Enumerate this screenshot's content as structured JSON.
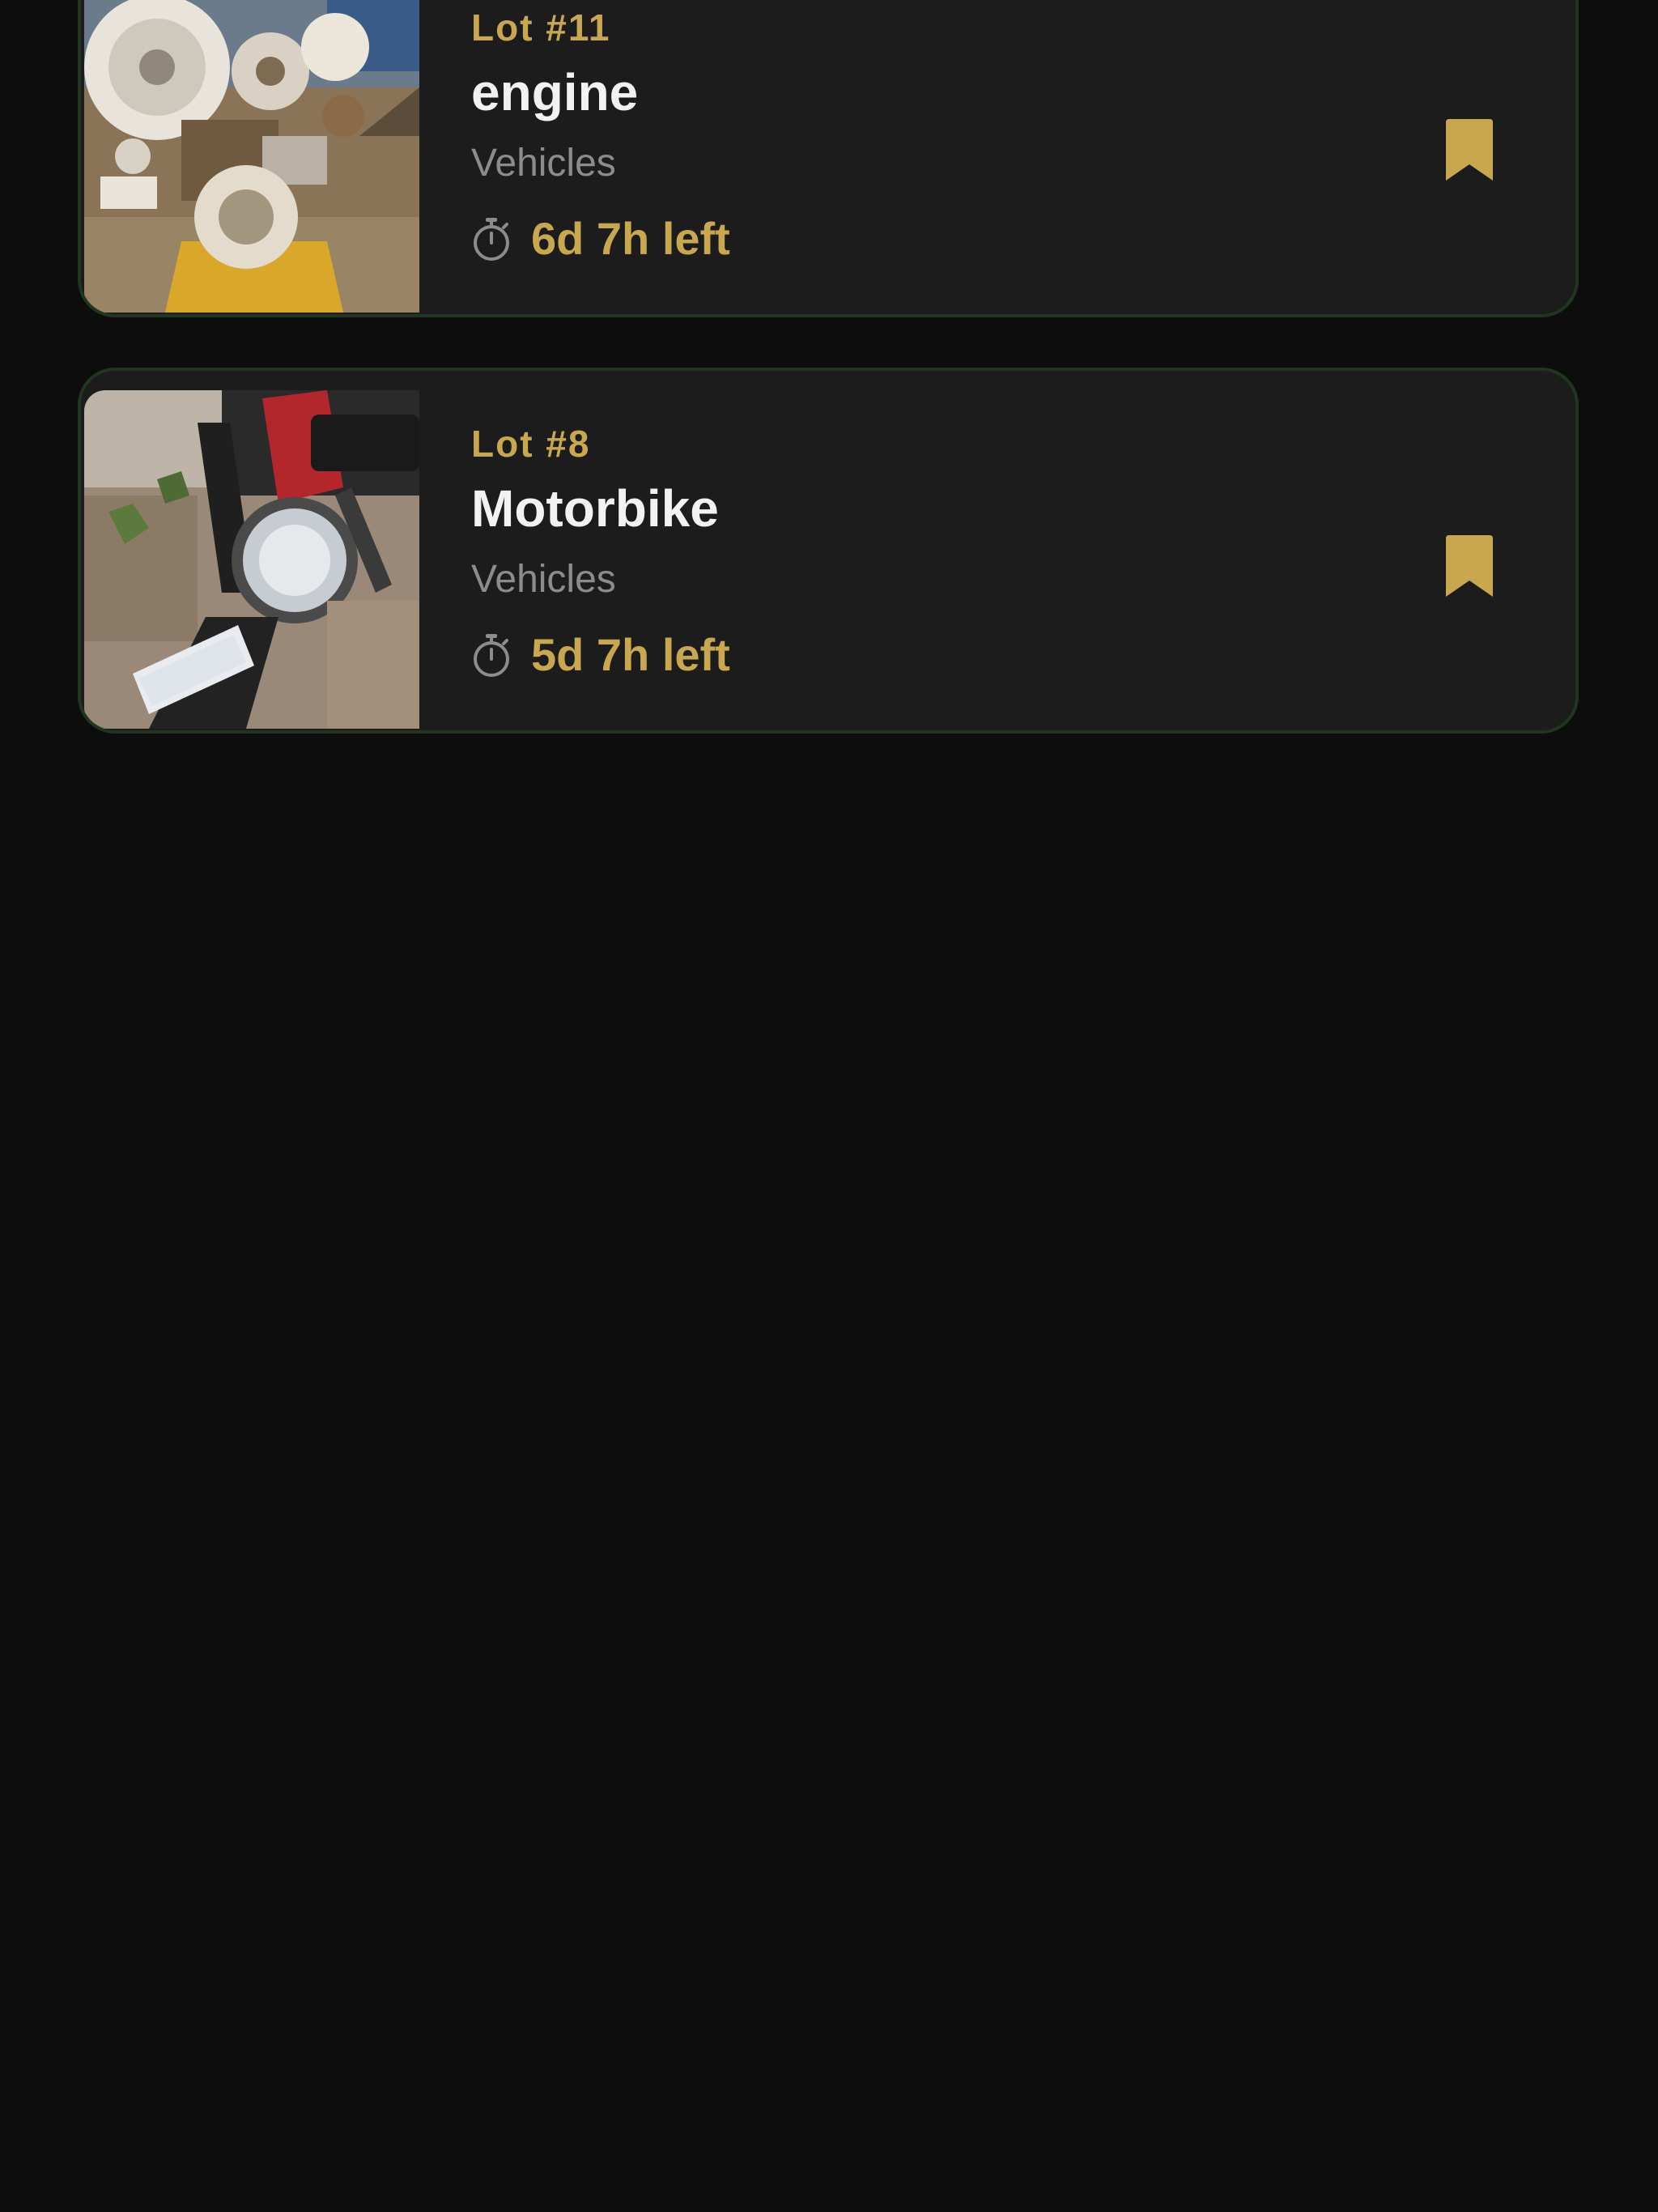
{
  "colors": {
    "background": "#0d0d0d",
    "card_background": "#1c1c1c",
    "card_border": "#213521",
    "accent_gold": "#c9a74e",
    "title_text": "#f2f2f2",
    "muted_text": "#8c8c8c"
  },
  "lots": [
    {
      "lot_number": "Lot #11",
      "title": "engine",
      "category": "Vehicles",
      "time_left": "6d 7h left",
      "image_icon": "engine-photo",
      "bookmark_icon": "bookmark-filled-icon",
      "timer_icon": "stopwatch-icon"
    },
    {
      "lot_number": "Lot #8",
      "title": "Motorbike",
      "category": "Vehicles",
      "time_left": "5d 7h left",
      "image_icon": "motorbike-photo",
      "bookmark_icon": "bookmark-filled-icon",
      "timer_icon": "stopwatch-icon"
    }
  ]
}
